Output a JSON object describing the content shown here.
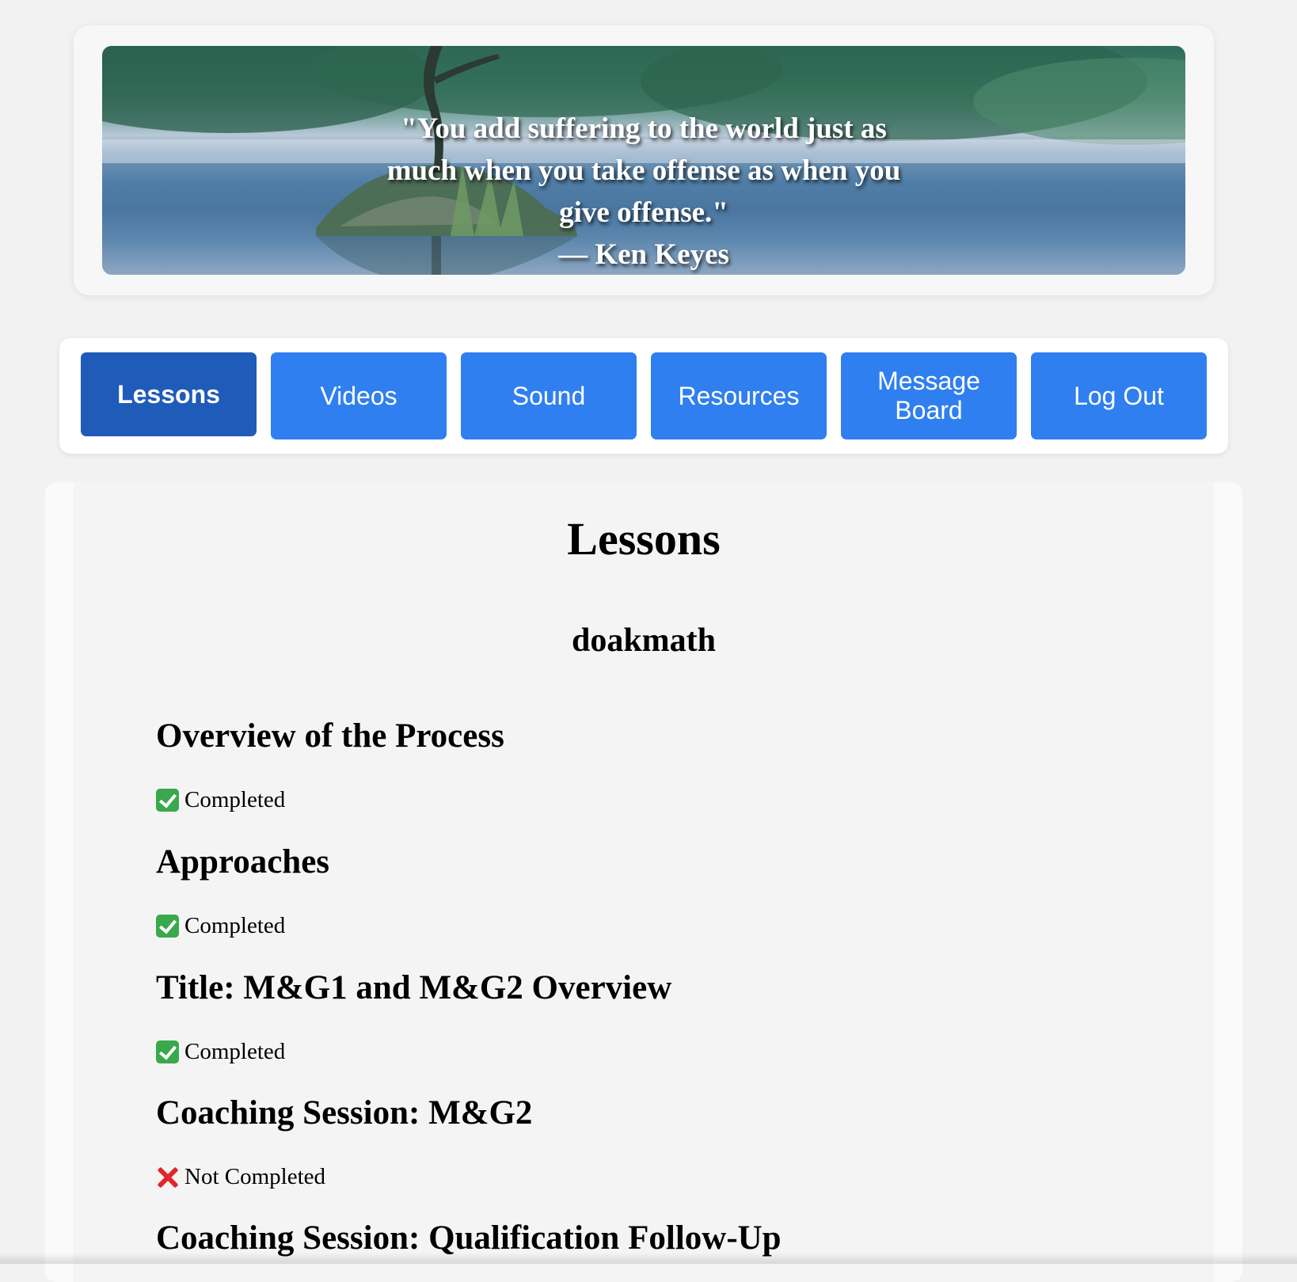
{
  "banner": {
    "quote": "\"You add suffering to the world just as much when you take offense as when you give offense.\"",
    "author": "— Ken Keyes"
  },
  "nav": {
    "items": [
      {
        "label": "Lessons",
        "active": true
      },
      {
        "label": "Videos",
        "active": false
      },
      {
        "label": "Sound",
        "active": false
      },
      {
        "label": "Resources",
        "active": false
      },
      {
        "label": "Message Board",
        "active": false
      },
      {
        "label": "Log Out",
        "active": false
      }
    ],
    "colors": {
      "button": "#2f7ff0",
      "active": "#1f5bb9"
    }
  },
  "main": {
    "title": "Lessons",
    "username": "doakmath",
    "lessons": [
      {
        "title": "Overview of the Process",
        "status": "Completed",
        "completed": true
      },
      {
        "title": "Approaches",
        "status": "Completed",
        "completed": true
      },
      {
        "title": "Title: M&G1 and M&G2 Overview",
        "status": "Completed",
        "completed": true
      },
      {
        "title": "Coaching Session: M&G2",
        "status": "Not Completed",
        "completed": false
      },
      {
        "title": "Coaching Session: Qualification Follow-Up"
      }
    ]
  },
  "icons": {
    "completed": "check-mark-icon",
    "not_completed": "cross-mark-icon"
  }
}
